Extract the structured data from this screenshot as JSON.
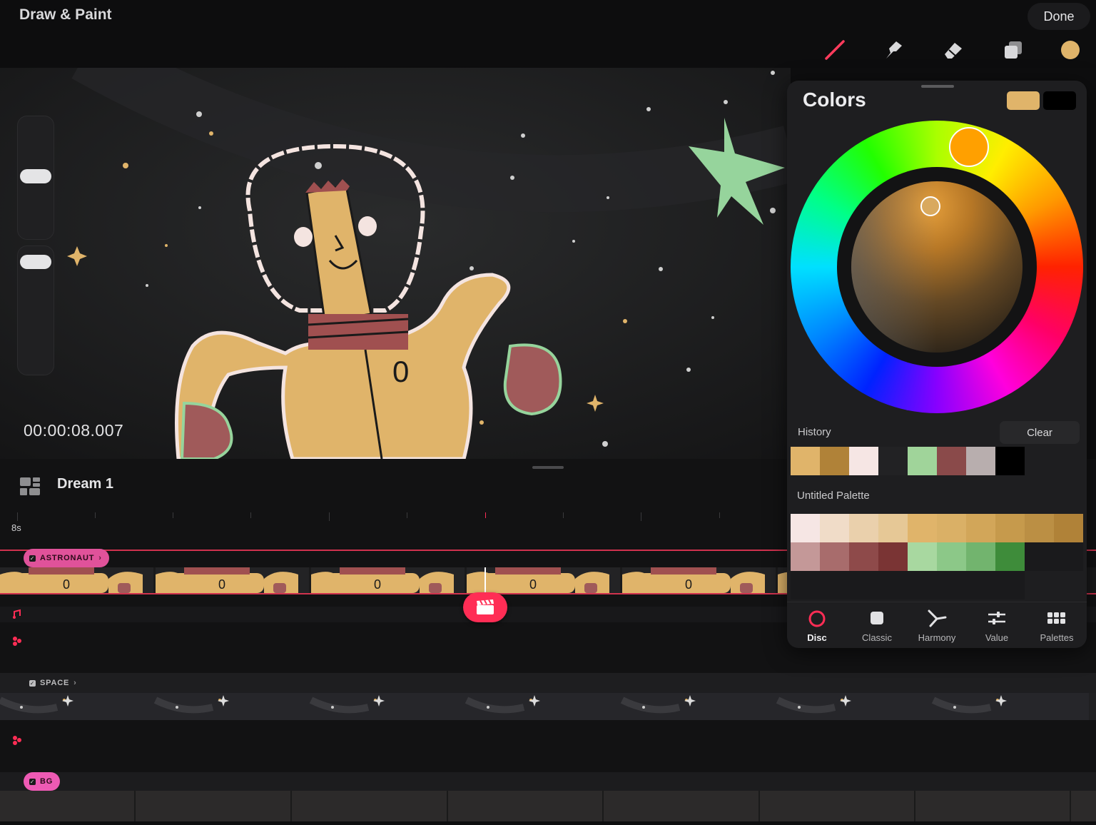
{
  "app": {
    "title": "Draw & Paint",
    "done_label": "Done"
  },
  "toolbar": {
    "tools": [
      "brush-tool",
      "smudge-tool",
      "eraser-tool",
      "layers-tool",
      "color-tool"
    ],
    "active_color": "#e0b46a"
  },
  "canvas": {
    "timecode": "00:00:08.007"
  },
  "timeline": {
    "project_name": "Dream 1",
    "time_scale": "8s",
    "tracks": [
      {
        "label": "ASTRONAUT",
        "color": "#e0529a"
      },
      {
        "label": "SPACE",
        "color": "#2a2a2c"
      },
      {
        "label": "BG",
        "color": "#ee5ab4"
      }
    ]
  },
  "colors_panel": {
    "title": "Colors",
    "primary_color": "#e0b46a",
    "secondary_color": "#000000",
    "history_label": "History",
    "clear_label": "Clear",
    "history": [
      "#e0b46a",
      "#b08238",
      "#f6e6e4",
      "#222224",
      "#a0d49a",
      "#8a4a4a",
      "#b8aeae",
      "#000000"
    ],
    "palette_name": "Untitled Palette",
    "palette": [
      "#f6e6e4",
      "#f0dcc8",
      "#ead0ac",
      "#e6c896",
      "#e0b46a",
      "#dab066",
      "#d2a659",
      "#c69a4c",
      "#bb8f44",
      "#b08238",
      "#c49898",
      "#a86c6c",
      "#8e4a4a",
      "#7a3434",
      "#a8d8a0",
      "#8cc888",
      "#72b46e",
      "#3e8c3a"
    ],
    "tabs": [
      {
        "label": "Disc",
        "icon": "disc-icon"
      },
      {
        "label": "Classic",
        "icon": "classic-icon"
      },
      {
        "label": "Harmony",
        "icon": "harmony-icon"
      },
      {
        "label": "Value",
        "icon": "value-icon"
      },
      {
        "label": "Palettes",
        "icon": "palettes-icon"
      }
    ],
    "active_tab": "Disc"
  }
}
